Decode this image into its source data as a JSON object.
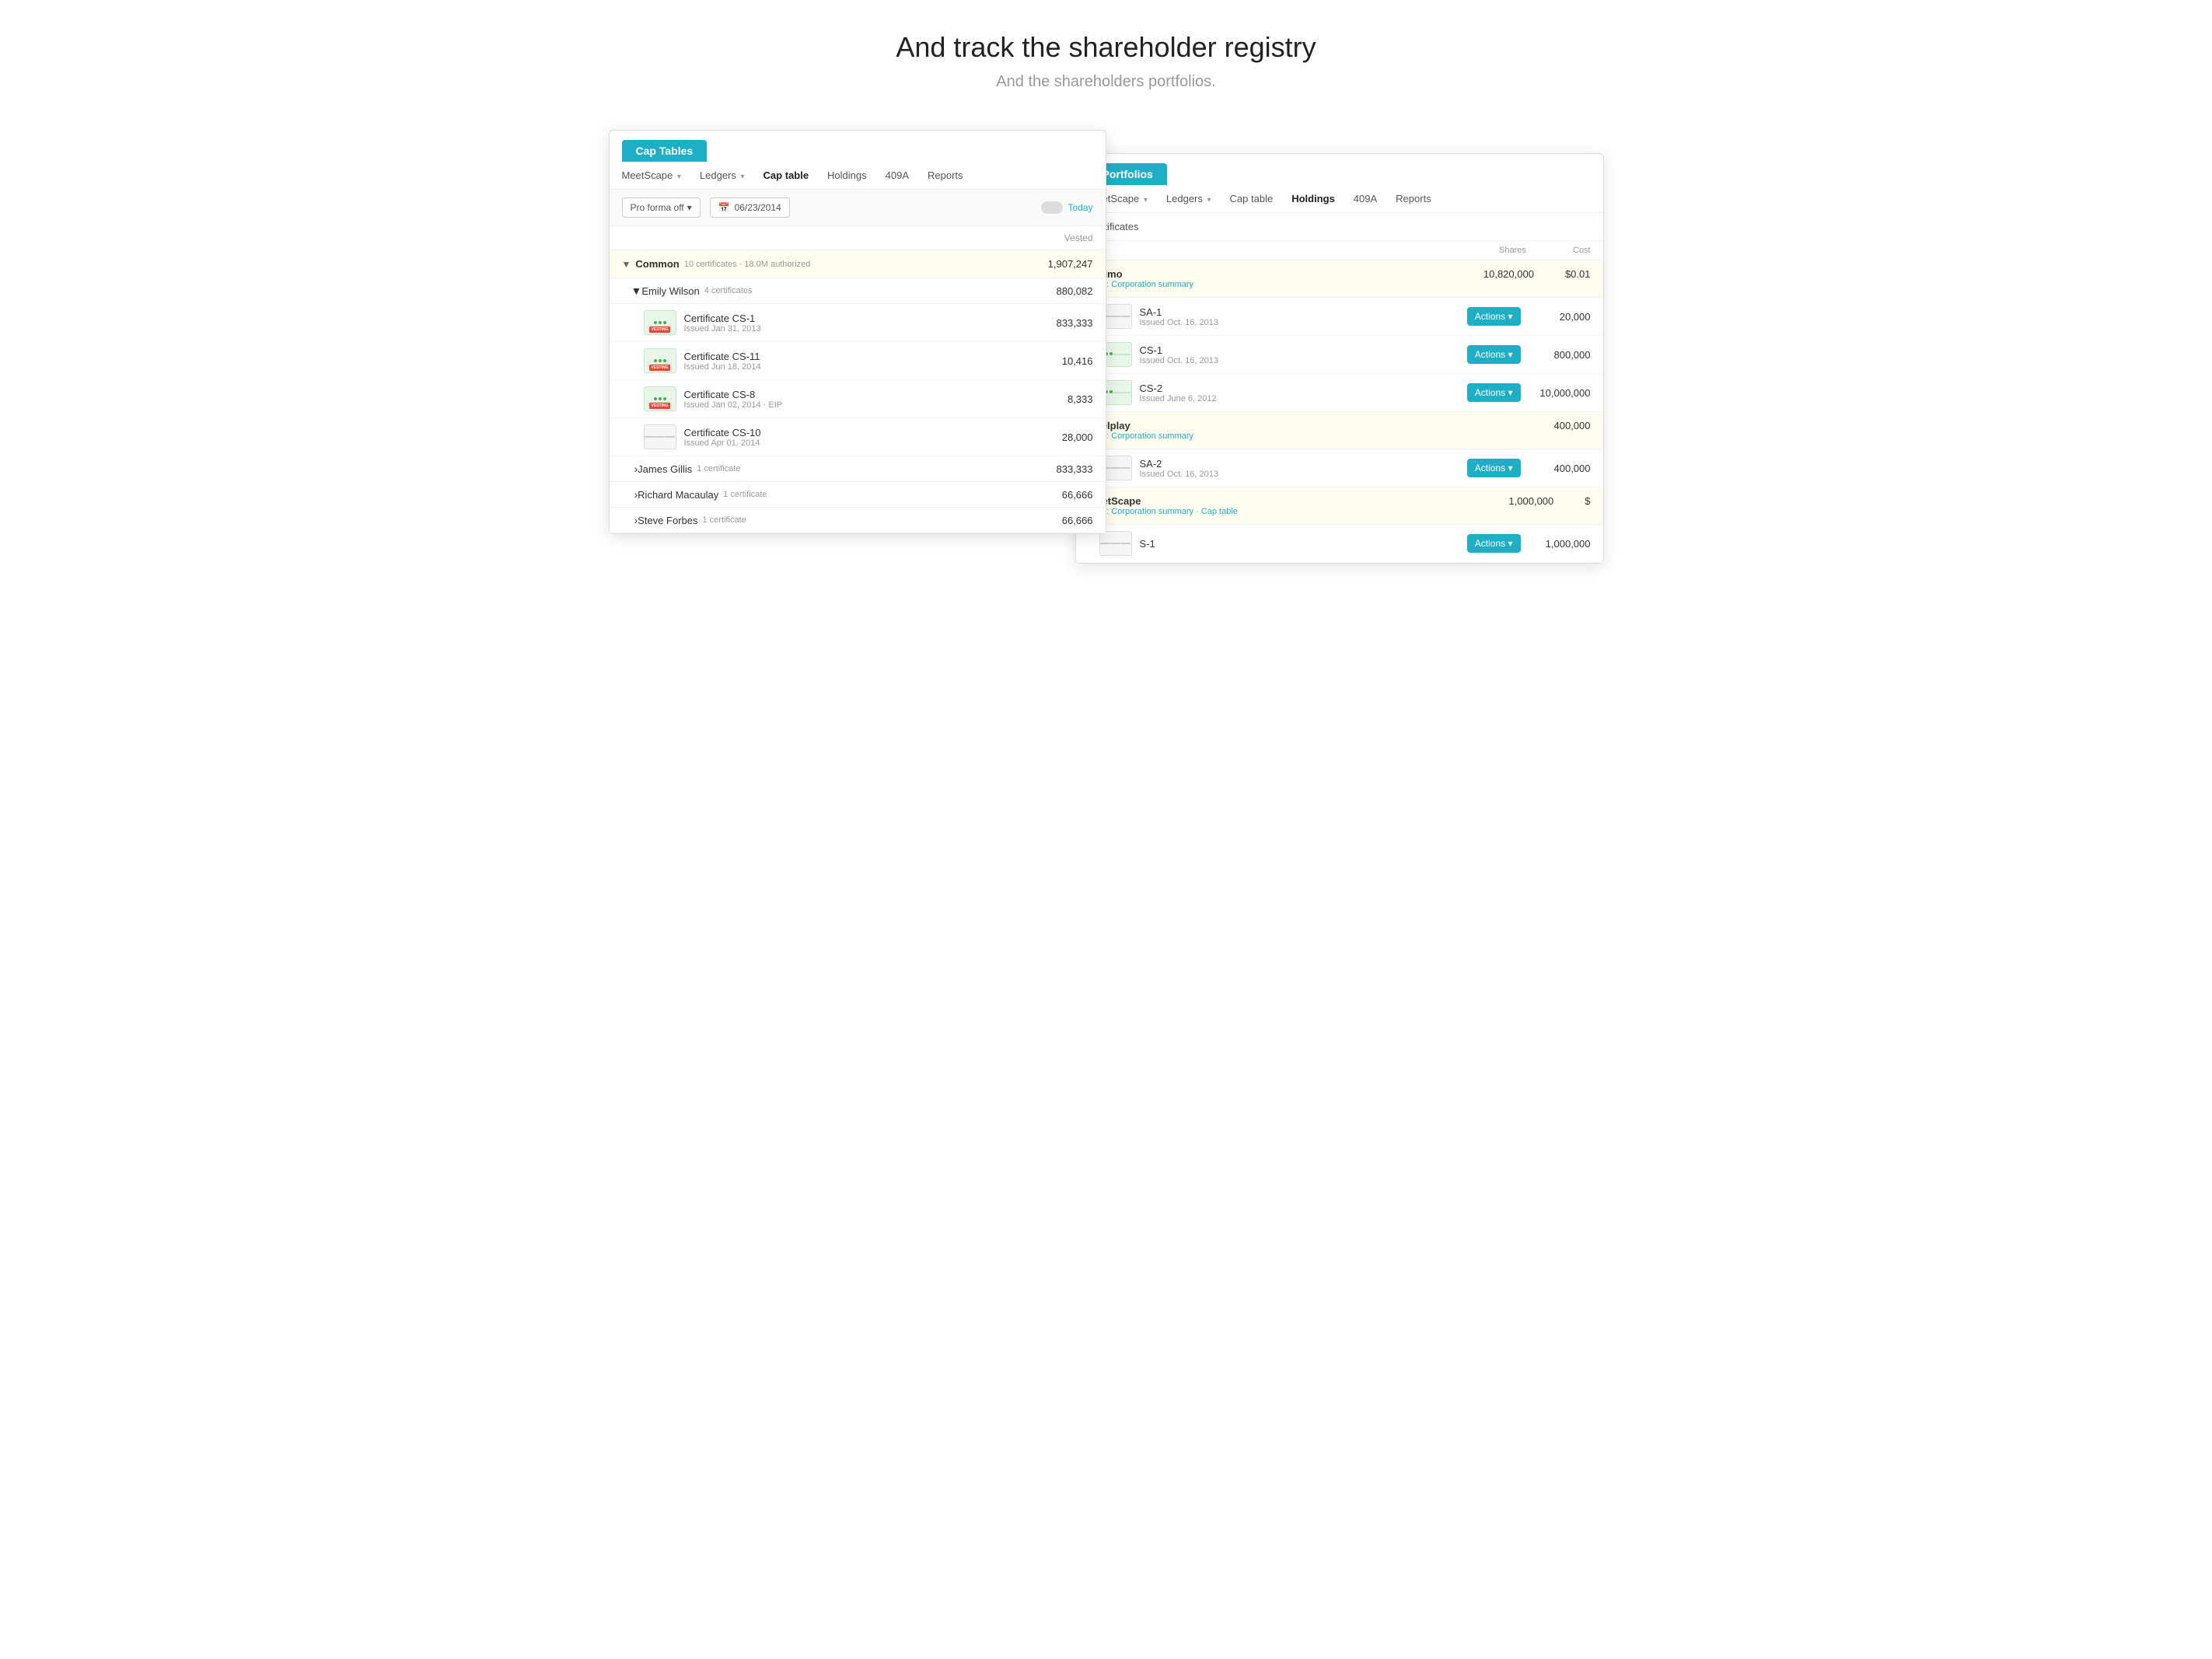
{
  "page": {
    "heading": "And track the shareholder registry",
    "subheading": "And the shareholders portfolios."
  },
  "cap_tables": {
    "window_title": "Cap Tables",
    "nav": {
      "items": [
        {
          "label": "MeetScape",
          "arrow": true,
          "active": false
        },
        {
          "label": "Ledgers",
          "arrow": true,
          "active": false
        },
        {
          "label": "Cap table",
          "arrow": false,
          "active": true
        },
        {
          "label": "Holdings",
          "arrow": false,
          "active": false
        },
        {
          "label": "409A",
          "arrow": false,
          "active": false
        },
        {
          "label": "Reports",
          "arrow": false,
          "active": false
        }
      ]
    },
    "toolbar": {
      "pro_forma": "Pro forma off",
      "date": "06/23/2014",
      "today_label": "Today"
    },
    "table": {
      "header_col": "Vested",
      "sections": [
        {
          "name": "Common",
          "meta": "10 certificates · 18.0M authorized",
          "value": "1,907,247",
          "expanded": true,
          "children": [
            {
              "name": "Emily Wilson",
              "meta": "4 certificates",
              "value": "880,082",
              "expanded": true,
              "certs": [
                {
                  "id": "Certificate CS-1",
                  "date": "Issued Jan 31, 2013",
                  "value": "833,333",
                  "type": "vesting"
                },
                {
                  "id": "Certificate CS-11",
                  "date": "Issued Jun 18, 2014",
                  "value": "10,416",
                  "type": "vesting"
                },
                {
                  "id": "Certificate CS-8",
                  "date": "Issued Jan 02, 2014 · EIP",
                  "value": "8,333",
                  "type": "vesting"
                },
                {
                  "id": "Certificate CS-10",
                  "date": "Issued Apr 01, 2014",
                  "value": "28,000",
                  "type": "plain"
                }
              ]
            },
            {
              "name": "James Gillis",
              "meta": "1 certificate",
              "value": "833,333",
              "expanded": false
            },
            {
              "name": "Richard Macaulay",
              "meta": "1 certificate",
              "value": "66,666",
              "expanded": false
            },
            {
              "name": "Steve Forbes",
              "meta": "1 certificate",
              "value": "66,666",
              "expanded": false
            }
          ]
        }
      ]
    }
  },
  "portfolios": {
    "window_title": "Portfolios",
    "nav": {
      "items": [
        {
          "label": "MeetScape",
          "arrow": true,
          "active": false
        },
        {
          "label": "Ledgers",
          "arrow": true,
          "active": false
        },
        {
          "label": "Cap table",
          "arrow": false,
          "active": false
        },
        {
          "label": "Holdings",
          "arrow": false,
          "active": true
        },
        {
          "label": "409A",
          "arrow": false,
          "active": false
        },
        {
          "label": "Reports",
          "arrow": false,
          "active": false
        }
      ]
    },
    "section_title": "Certificates",
    "table_headers": [
      "Shares",
      "Cost"
    ],
    "companies": [
      {
        "name": "Nojimo",
        "link_text": "View: Corporation summary",
        "total_shares": "10,820,000",
        "total_cost": "$0.01",
        "certs": [
          {
            "id": "SA-1",
            "date": "Issued Oct. 16, 2013",
            "value": "20,000",
            "type": "plain"
          },
          {
            "id": "CS-1",
            "date": "Issued Oct. 16, 2013",
            "value": "800,000",
            "type": "green"
          },
          {
            "id": "CS-2",
            "date": "Issued June 6, 2012",
            "value": "10,000,000",
            "type": "green"
          }
        ]
      },
      {
        "name": "Duelplay",
        "link_text": "View: Corporation summary",
        "total_shares": "400,000",
        "total_cost": "",
        "certs": [
          {
            "id": "SA-2",
            "date": "Issued Oct. 16, 2013",
            "value": "400,000",
            "type": "plain"
          }
        ]
      },
      {
        "name": "MeetScape",
        "link_text": "View: Corporation summary · Cap table",
        "total_shares": "1,000,000",
        "total_cost": "$",
        "certs": [
          {
            "id": "S-1",
            "date": "",
            "value": "1,000,000",
            "type": "plain"
          }
        ]
      }
    ]
  }
}
